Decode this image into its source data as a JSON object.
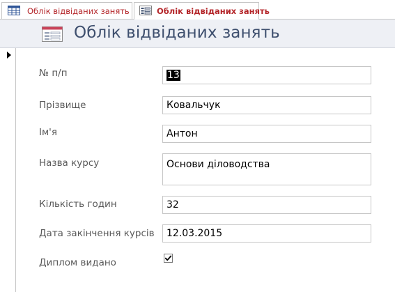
{
  "tabs": [
    {
      "label": "Облік відвіданих занять",
      "icon": "table-icon",
      "active": false
    },
    {
      "label": "Облік відвіданих занять",
      "icon": "form-icon",
      "active": true
    }
  ],
  "form": {
    "title": "Облік відвіданих занять",
    "icon": "form-icon"
  },
  "record_selector": {
    "icon": "current-record-pointer-icon"
  },
  "fields": [
    {
      "label": "№ п/п",
      "value": "13",
      "selected": true
    },
    {
      "label": "Прізвище",
      "value": "Ковальчук"
    },
    {
      "label": "Ім'я",
      "value": "Антон"
    },
    {
      "label": "Назва курсу",
      "value": "Основи діловодства"
    },
    {
      "label": "Кількість годин",
      "value": "32"
    },
    {
      "label": "Дата закінчення курсів",
      "value": "12.03.2015"
    },
    {
      "label": "Диплом видано",
      "value": true,
      "control": "checkbox"
    }
  ],
  "colors": {
    "tab_text": "#b4262a",
    "header_band": "#eef0f5",
    "title_text": "#3e4f6e",
    "label_text": "#595959",
    "border": "#c6c6c6"
  }
}
